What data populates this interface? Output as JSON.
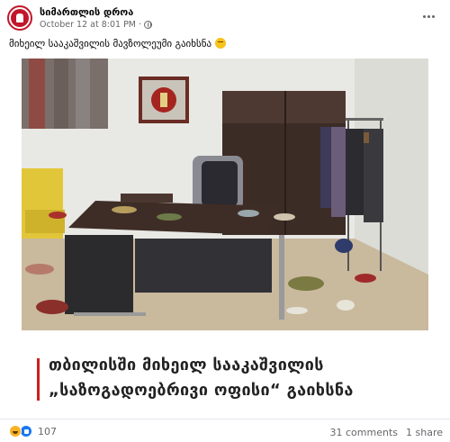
{
  "post": {
    "page_name": "სიმართლის დროა",
    "timestamp": "October 12 at 8:01 PM",
    "caption": "მიხეილ სააკაშვილის მავზოლეუმი გაიხსნა",
    "caption_emoji": "grimacing-face-emoji"
  },
  "headline": {
    "line1": "თბილისში მიხეილ სააკაშვილის",
    "line2": "„საზოგადოებრივი ოფისი“ გაიხსნა",
    "accent_color": "#cc1f1f"
  },
  "footer": {
    "reaction_icons": [
      "laugh-reaction-icon",
      "like-reaction-icon"
    ],
    "reaction_count": "107",
    "comments": "31 comments",
    "shares": "1 share"
  },
  "colors": {
    "brand": "#c2162a",
    "secondary_text": "#65676b"
  }
}
